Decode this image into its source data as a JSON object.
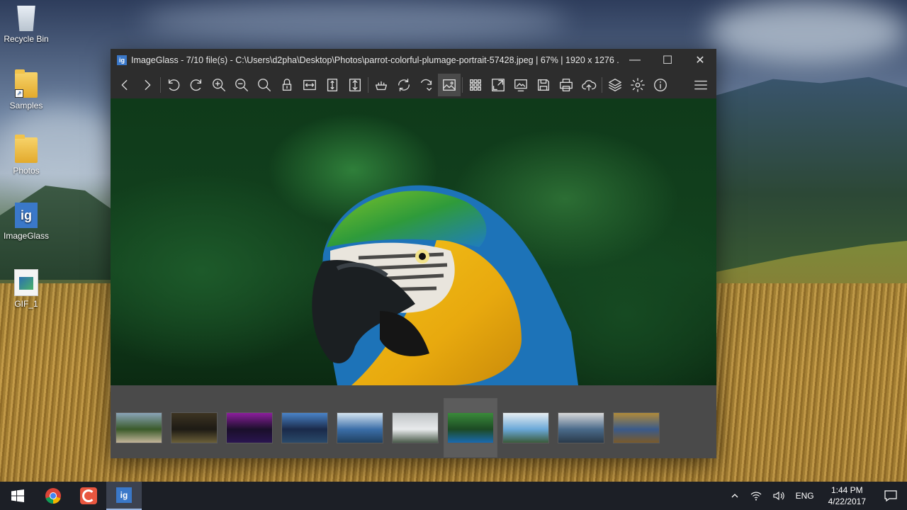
{
  "desktop": {
    "icons": [
      {
        "label": "Recycle Bin"
      },
      {
        "label": "Samples"
      },
      {
        "label": "Photos"
      },
      {
        "label": "ImageGlass"
      },
      {
        "label": "GIF_1"
      }
    ]
  },
  "window": {
    "title": "ImageGlass - 7/10 file(s) - C:\\Users\\d2pha\\Desktop\\Photos\\parrot-colorful-plumage-portrait-57428.jpeg  |  67%  |  1920 x 1276 ...",
    "app_icon_text": "ig",
    "controls": {
      "minimize": "—",
      "maximize": "☐",
      "close": "✕"
    },
    "toolbar_buttons": [
      "previous-image",
      "next-image",
      "rotate-left",
      "rotate-right",
      "zoom-in",
      "zoom-out",
      "scale-to-fit",
      "lock-zoom",
      "fit-width",
      "fit-height",
      "scale-to-fill",
      "image-editing",
      "refresh",
      "go-to-image",
      "auto-zoom",
      "thumbnail-bar",
      "fullscreen",
      "slideshow",
      "save",
      "print",
      "upload",
      "plugins",
      "settings",
      "about",
      "main-menu"
    ],
    "active_tool": "auto-zoom",
    "thumbnails": [
      {
        "colors": [
          "#3a5a2a",
          "#8aa4b8",
          "#c4b59a"
        ]
      },
      {
        "colors": [
          "#1d1a14",
          "#3d3422",
          "#6b5f38"
        ]
      },
      {
        "colors": [
          "#1a0f2a",
          "#8c1f9c",
          "#2a1550"
        ]
      },
      {
        "colors": [
          "#1a2a4a",
          "#4a84c8",
          "#2a4a6a"
        ]
      },
      {
        "colors": [
          "#3b6ea8",
          "#d4e4f0",
          "#204060"
        ]
      },
      {
        "colors": [
          "#e8eaec",
          "#c0c4c6",
          "#4a5a4a"
        ]
      },
      {
        "colors": [
          "#1c4a24",
          "#3a8a3a",
          "#1a6ab0"
        ]
      },
      {
        "colors": [
          "#6aa8d8",
          "#e8eef2",
          "#3a5a3a"
        ]
      },
      {
        "colors": [
          "#4a6a8a",
          "#d8d8d8",
          "#2a3a4a"
        ]
      },
      {
        "colors": [
          "#3a5a8a",
          "#b08a3a",
          "#7a5a2a"
        ]
      }
    ],
    "selected_thumbnail": 7
  },
  "taskbar": {
    "apps": [
      "windows-start",
      "chrome",
      "screen-recorder",
      "imageglass"
    ],
    "language": "ENG",
    "time": "1:44 PM",
    "date": "4/22/2017"
  }
}
